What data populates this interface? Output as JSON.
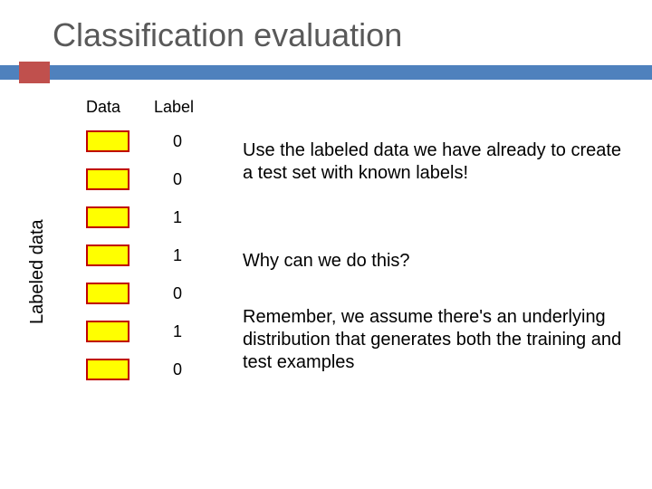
{
  "title": "Classification evaluation",
  "headers": {
    "data": "Data",
    "label": "Label"
  },
  "ylabel": "Labeled data",
  "rows": [
    {
      "label": "0"
    },
    {
      "label": "0"
    },
    {
      "label": "1"
    },
    {
      "label": "1"
    },
    {
      "label": "0"
    },
    {
      "label": "1"
    },
    {
      "label": "0"
    }
  ],
  "paragraphs": {
    "p1": "Use the labeled data we have already to create a test set with known labels!",
    "p2": "Why can we do this?",
    "p3": "Remember, we assume there's an underlying distribution that generates both the training and test examples"
  }
}
